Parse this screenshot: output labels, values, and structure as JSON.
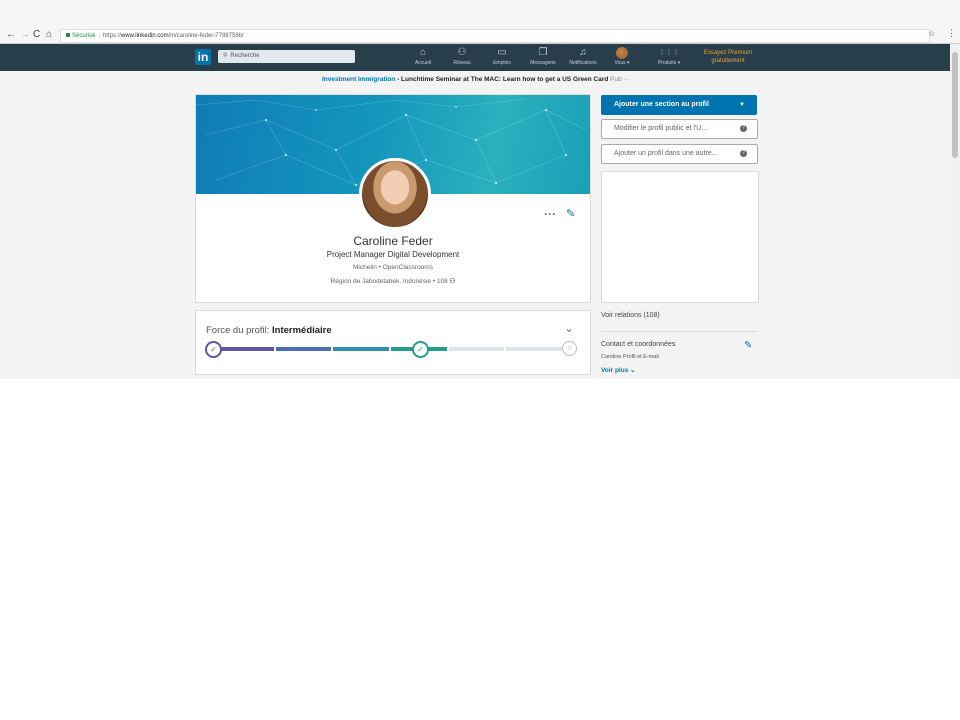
{
  "browser": {
    "back": "←",
    "forward": "→",
    "reload": "C",
    "home": "⌂",
    "secure_label": "Sécurisé",
    "url_prefix": "https://",
    "url_host": "www.linkedin.com",
    "url_path": "/in/caroline-feder-7788758b/",
    "bookmark_glyph": "☆",
    "menu_glyph": "⋮"
  },
  "nav": {
    "logo": "in",
    "search_placeholder": "Recherche",
    "items": [
      {
        "icon": "home-icon",
        "glyph": "⌂",
        "label": "Accueil"
      },
      {
        "icon": "people-icon",
        "glyph": "⚇",
        "label": "Réseau"
      },
      {
        "icon": "briefcase-icon",
        "glyph": "▭",
        "label": "Emplois"
      },
      {
        "icon": "message-icon",
        "glyph": "❐",
        "label": "Messagerie"
      },
      {
        "icon": "bell-icon",
        "glyph": "♫",
        "label": "Notifications"
      },
      {
        "icon": "avatar",
        "glyph": "",
        "label": "Vous ▾"
      },
      {
        "icon": "grid-icon",
        "glyph": "⋮⋮⋮",
        "label": "Produits ▾"
      }
    ],
    "premium_line1": "Essayez Premium",
    "premium_line2": "gratuitement"
  },
  "ad": {
    "link": "Investment Immigration",
    "text": " - Lunchtime Seminar at The MAC: Learn how to get a US Green Card",
    "tag": "Pub ···"
  },
  "profile": {
    "name": "Caroline Feder",
    "headline": "Project Manager Digital Development",
    "companies": "Michelin • OpenClassrooms",
    "location": "Région de Jabodetabek, Indonésie • 108"
  },
  "strength": {
    "label": "Force du profil: ",
    "level": "Intermédiaire",
    "progress": 0.61
  },
  "sidebar": {
    "add_section": "Ajouter une section au profil",
    "edit_public": "Modifier le profil public et l'U...",
    "add_profile": "Ajouter un profil dans une autre...",
    "see_connections": "Voir relations (108)",
    "contact_title": "Contact et coordonnées",
    "contact_sub": "Caroline Profil et E-mail",
    "see_more": "Voir plus"
  },
  "colors": {
    "nav_bg": "#283e4a",
    "brand": "#0073b1",
    "premium": "#e7a33e"
  }
}
